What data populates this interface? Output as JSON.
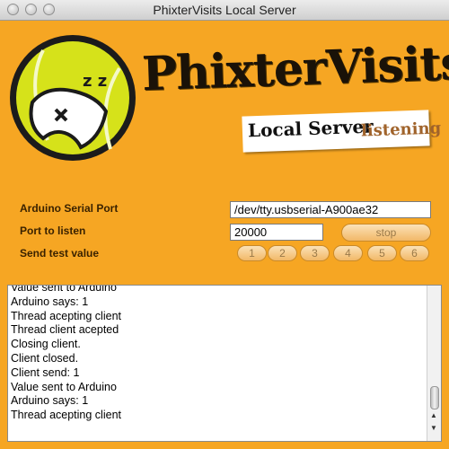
{
  "window": {
    "title": "PhixterVisits Local Server"
  },
  "brand": {
    "name": "PhixterVisits",
    "subtitle": "Local Server",
    "status": "listening",
    "logo_text": "z z"
  },
  "form": {
    "serial_port_label": "Arduino Serial Port",
    "serial_port_value": "/dev/tty.usbserial-A900ae32",
    "port_label": "Port to listen",
    "port_value": "20000",
    "stop_label": "stop",
    "test_label": "Send test value",
    "test_values": [
      "1",
      "2",
      "3",
      "4",
      "5",
      "6"
    ]
  },
  "log": {
    "lines": [
      "Value sent to Arduino",
      "Arduino says: 1",
      "Thread acepting client",
      "Thread client acepted",
      "Closing client.",
      "Client closed.",
      "Client send: 1",
      "Value sent to Arduino",
      "Arduino says: 1",
      "Thread acepting client"
    ]
  },
  "colors": {
    "background": "#f6a623",
    "ball": "#d6e21a",
    "status": "#a0632b"
  },
  "icons": {
    "close": "close-icon",
    "minimize": "minimize-icon",
    "zoom": "zoom-icon"
  }
}
